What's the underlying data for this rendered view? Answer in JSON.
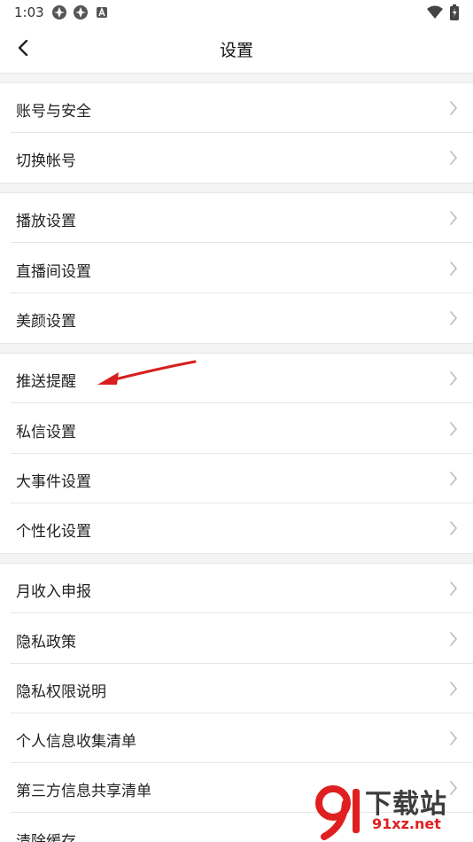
{
  "status_bar": {
    "time": "1:03"
  },
  "nav": {
    "title": "设置"
  },
  "groups": [
    {
      "items": [
        {
          "label": "账号与安全"
        },
        {
          "label": "切换帐号"
        }
      ]
    },
    {
      "items": [
        {
          "label": "播放设置"
        },
        {
          "label": "直播间设置"
        },
        {
          "label": "美颜设置"
        }
      ]
    },
    {
      "items": [
        {
          "label": "推送提醒"
        },
        {
          "label": "私信设置"
        },
        {
          "label": "大事件设置"
        },
        {
          "label": "个性化设置"
        }
      ]
    },
    {
      "items": [
        {
          "label": "月收入申报"
        },
        {
          "label": "隐私政策"
        },
        {
          "label": "隐私权限说明"
        },
        {
          "label": "个人信息收集清单"
        },
        {
          "label": "第三方信息共享清单"
        },
        {
          "label": "清除缓存"
        }
      ]
    }
  ],
  "watermark": {
    "text": "下载站",
    "sub": "91xz.net"
  },
  "colors": {
    "annotation_arrow": "#d81e1e",
    "chevron": "#bbbbbb",
    "separator": "#f4f4f4"
  }
}
